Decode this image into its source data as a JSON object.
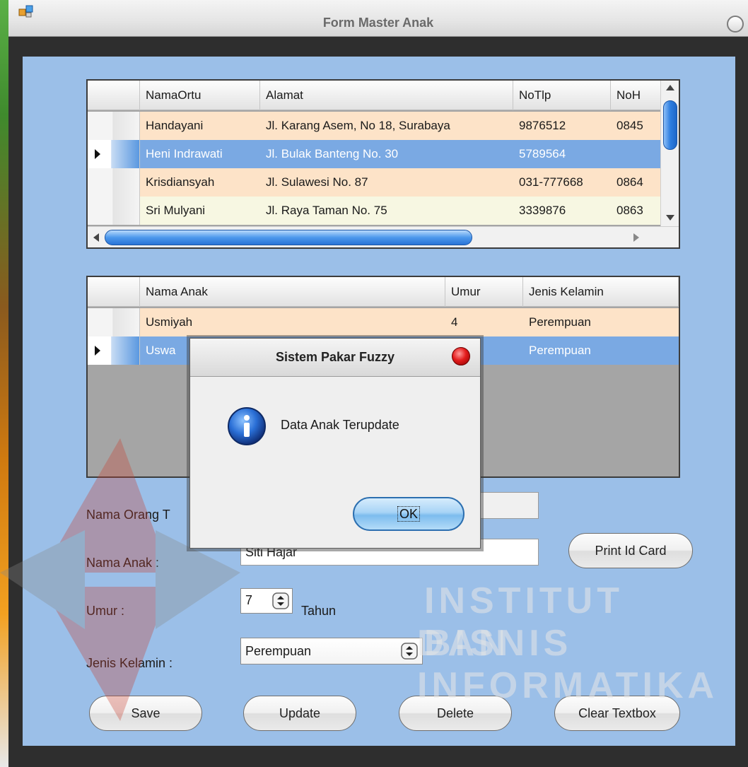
{
  "window": {
    "title": "Form Master Anak"
  },
  "parents_grid": {
    "headers": [
      "NamaOrtu",
      "Alamat",
      "NoTlp",
      "NoH"
    ],
    "rows": [
      {
        "nama": "Handayani",
        "alamat": "Jl. Karang Asem, No 18, Surabaya",
        "notlp": "9876512",
        "nohp": "0845"
      },
      {
        "nama": "Heni Indrawati",
        "alamat": "Jl. Bulak Banteng No. 30",
        "notlp": "5789564",
        "nohp": ""
      },
      {
        "nama": "Krisdiansyah",
        "alamat": "Jl. Sulawesi No. 87",
        "notlp": "031-777668",
        "nohp": "0864"
      },
      {
        "nama": "Sri Mulyani",
        "alamat": "Jl. Raya Taman No. 75",
        "notlp": "3339876",
        "nohp": "0863"
      }
    ]
  },
  "children_grid": {
    "headers": [
      "Nama Anak",
      "Umur",
      "Jenis Kelamin"
    ],
    "rows": [
      {
        "nama": "Usmiyah",
        "umur": "4",
        "jk": "Perempuan"
      },
      {
        "nama": "Uswa",
        "umur": "",
        "jk": "Perempuan"
      }
    ]
  },
  "form": {
    "nama_ortu_label": "Nama Orang T",
    "nama_ortu_value": "",
    "nama_anak_label": "Nama Anak :",
    "nama_anak_value": "Siti Hajar",
    "umur_label": "Umur :",
    "umur_value": "7",
    "umur_unit": "Tahun",
    "jenis_kelamin_label": "Jenis Kelamin :",
    "jenis_kelamin_value": "Perempuan",
    "print_button": "Print Id Card",
    "save_button": "Save",
    "update_button": "Update",
    "delete_button": "Delete",
    "clear_button": "Clear Textbox"
  },
  "dialog": {
    "title": "Sistem Pakar Fuzzy",
    "message": "Data Anak Terupdate",
    "ok_button": "OK"
  },
  "watermark": {
    "line1": "INSTITUT BISNIS",
    "line2": "DAN INFORMATIKA"
  },
  "colors": {
    "client_bg": "#9bbfe8",
    "row_peach": "#fde3c8",
    "row_cream": "#f7f7e2",
    "row_selected": "#7aa9e3"
  },
  "icons": [
    "app-icon",
    "info-icon",
    "close-icon",
    "row-selector-arrow-icon",
    "spinner-arrows-icon",
    "combo-arrows-icon"
  ]
}
